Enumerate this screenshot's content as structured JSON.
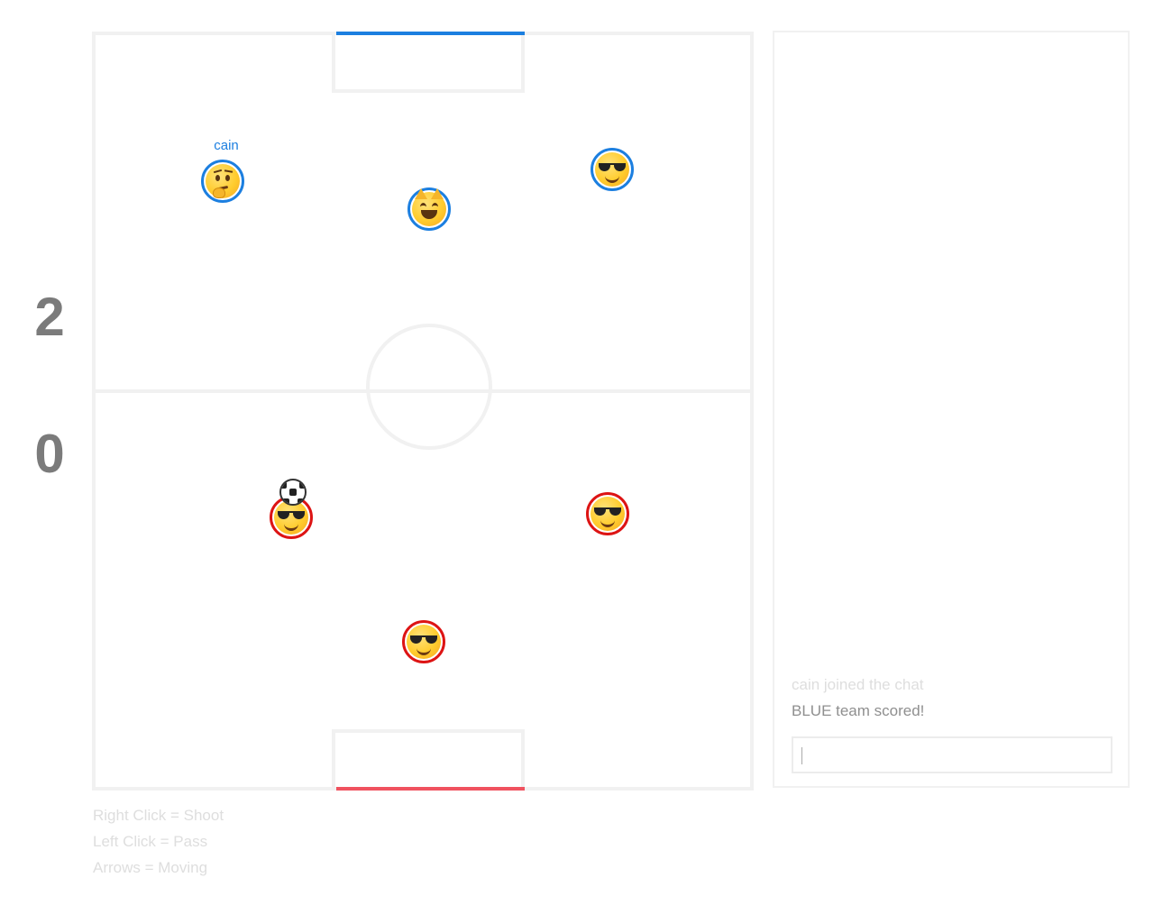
{
  "scoreboard": {
    "blue": "2",
    "red": "0"
  },
  "colors": {
    "blue_team": "#1c7fe0",
    "red_team": "#dd1414",
    "field_lines": "#f1f1f1",
    "score_text": "#7b7b7b"
  },
  "players": {
    "current": {
      "name": "cain",
      "team": "blue",
      "icon": "thinking-face-icon"
    },
    "blue": [
      "thinking-face-icon",
      "grinning-cat-icon",
      "sunglasses-face-icon"
    ],
    "red": [
      "sunglasses-face-icon",
      "sunglasses-face-icon",
      "sunglasses-face-icon"
    ]
  },
  "ball": {
    "icon": "soccer-ball-icon"
  },
  "chat": {
    "messages": [
      "cain joined the chat",
      "BLUE team scored!"
    ],
    "input_value": ""
  },
  "controls_help": [
    "Right Click = Shoot",
    "Left Click = Pass",
    "Arrows = Moving"
  ]
}
